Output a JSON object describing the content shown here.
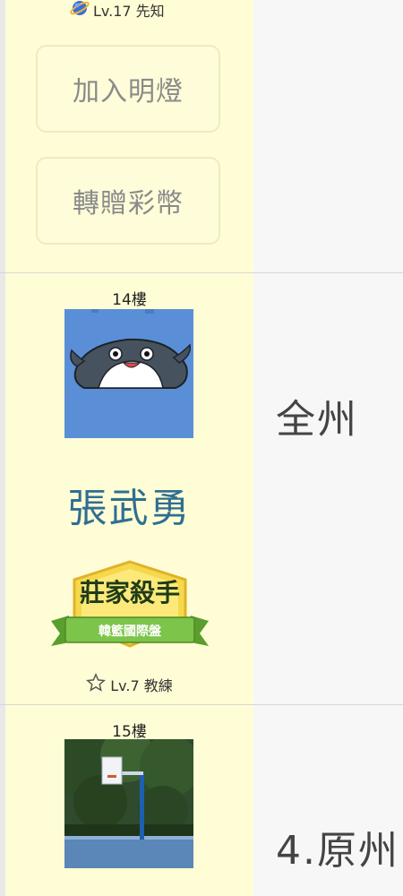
{
  "posts": [
    {
      "level_text": "Lv.17 先知",
      "level_icon": "planet-icon",
      "buttons": {
        "join_light": "加入明燈",
        "gift_coins": "轉贈彩幣"
      }
    },
    {
      "floor": "14樓",
      "username": "張武勇",
      "badge": {
        "title": "莊家殺手",
        "subtitle": "韓籃國際盤"
      },
      "level_text": "Lv.7 教練",
      "level_icon": "star-outline-icon",
      "content": "全州"
    },
    {
      "floor": "15樓",
      "content": "4.原州"
    }
  ],
  "colors": {
    "sidebar_bg": "#fffdd6",
    "content_bg": "#f7f7f8",
    "username": "#2f6e91",
    "button_text": "#8a8a8a"
  }
}
